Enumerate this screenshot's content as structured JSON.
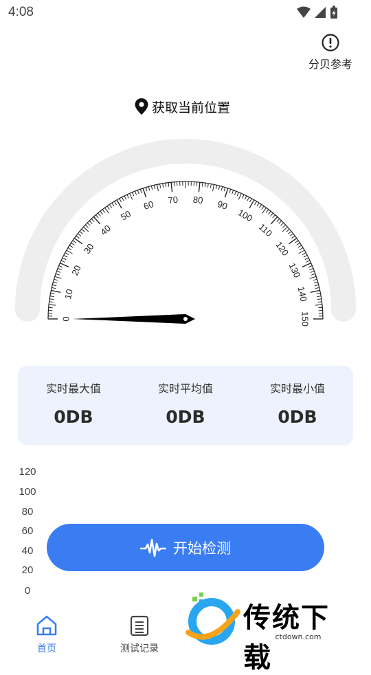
{
  "status_bar": {
    "time": "4:08"
  },
  "header": {
    "reference_label": "分贝参考"
  },
  "location": {
    "label": "获取当前位置"
  },
  "gauge": {
    "min": 0,
    "max": 150,
    "major_step": 10,
    "minor_step": 1,
    "labels": [
      "0",
      "10",
      "20",
      "30",
      "40",
      "50",
      "60",
      "70",
      "80",
      "90",
      "100",
      "110",
      "120",
      "130",
      "140",
      "150"
    ],
    "current_value": 0,
    "track_color": "#eeeeee",
    "needle_color": "#000000"
  },
  "stats": {
    "realtime_max_label": "实时最大值",
    "realtime_max_value": "0DB",
    "realtime_avg_label": "实时平均值",
    "realtime_avg_value": "0DB",
    "realtime_min_label": "实时最小值",
    "realtime_min_value": "0DB"
  },
  "chart": {
    "y_ticks": [
      "120",
      "100",
      "80",
      "60",
      "40",
      "20",
      "0"
    ]
  },
  "action": {
    "start_label": "开始检测",
    "color": "#3a7df3"
  },
  "nav": {
    "home_label": "首页",
    "records_label": "测试记录",
    "active_color": "#3a7df3",
    "inactive_color": "#444444"
  },
  "watermark": {
    "title": "传统下载",
    "url": "ctdown.com"
  }
}
